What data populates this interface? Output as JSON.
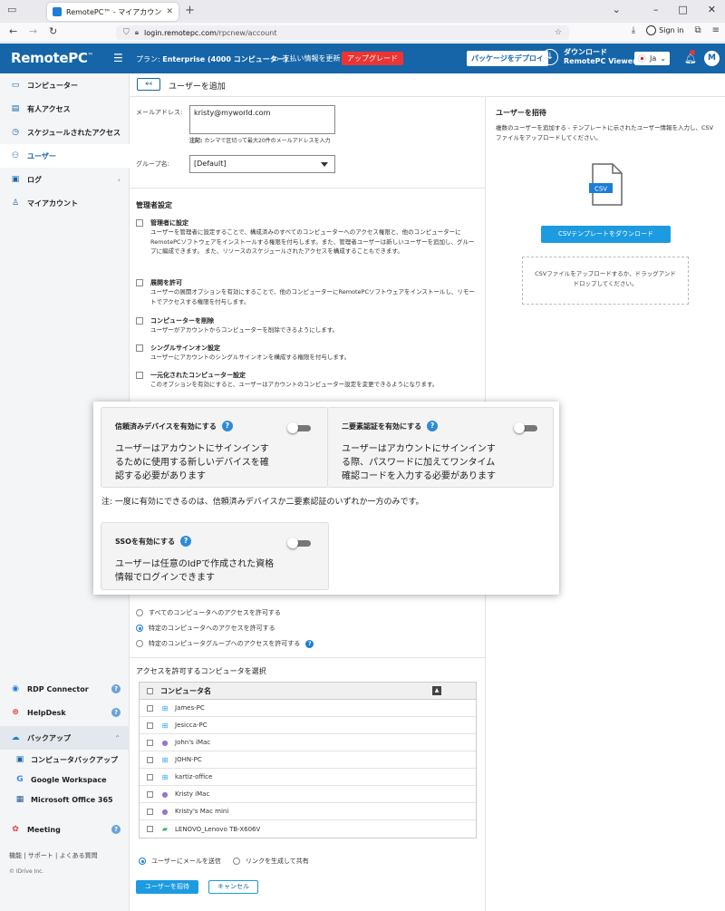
{
  "browser": {
    "tab_title": "RemotePC™ - マイアカウント-M",
    "url_host": "login.remotepc.com",
    "url_path": "/rpcnew/account",
    "signin_label": "Sign in"
  },
  "header": {
    "logo": "RemotePC",
    "logo_tm": "™",
    "plan_prefix": "プラン:",
    "plan_value": "Enterprise (4000 コンピューター)",
    "billing_label": "支払い情報を更新",
    "upgrade_label": "アップグレード",
    "deploy_label": "パッケージをデプロイ",
    "download_line1": "ダウンロード",
    "download_line2": "RemotePC Viewer",
    "lang_label": "Ja",
    "avatar_letter": "M"
  },
  "sidebar": {
    "items": [
      {
        "label": "コンピューター",
        "icon": "monitor-icon"
      },
      {
        "label": "有人アクセス",
        "icon": "attended-icon"
      },
      {
        "label": "スケジュールされたアクセス",
        "icon": "schedule-icon"
      },
      {
        "label": "ユーザー",
        "icon": "users-icon"
      },
      {
        "label": "ログ",
        "icon": "log-icon"
      },
      {
        "label": "マイアカウント",
        "icon": "account-icon"
      }
    ],
    "bottom": {
      "rdp": "RDP Connector",
      "helpdesk": "HelpDesk",
      "backup": "バックアップ",
      "backup_sub": [
        "コンピュータバックアップ",
        "Google Workspace",
        "Microsoft Office 365"
      ],
      "meeting": "Meeting"
    },
    "footer_links": "機能 | サポート | よくある質問",
    "copyright": "© IDrive Inc."
  },
  "page": {
    "title": "ユーザーを追加",
    "back_label": "↤"
  },
  "form": {
    "email_label": "メールアドレス:",
    "email_value": "kristy@myworld.com",
    "hint_bold": "注記:",
    "hint_text": " カンマで区切って最大20件のメールアドレスを入力",
    "group_label": "グループ名:",
    "group_value": "[Default]",
    "admin_section": "管理者設定",
    "permissions": [
      {
        "title": "管理者に設定",
        "desc": "ユーザーを管理者に設定することで、構成済みのすべてのコンピューターへのアクセス権限と、他のコンピューターにRemotePCソフトウェアをインストールする権限を付与します。また、管理者ユーザーは新しいユーザーを追加し、グループに編成できます。 また、リソースのスケジュールされたアクセスを構成することもできます。"
      },
      {
        "title": "展開を許可",
        "desc": "ユーザーの展開オプションを有効にすることで、他のコンピューターにRemotePCソフトウェアをインストールし、リモートでアクセスする権限を付与します。"
      },
      {
        "title": "コンピューターを削除",
        "desc": "ユーザーがアカウントからコンピューターを削除できるようにします。"
      },
      {
        "title": "シングルサインオン設定",
        "desc": "ユーザーにアカウントのシングルサインオンを構成する権限を付与します。"
      },
      {
        "title": "一元化されたコンピューター設定",
        "desc": "このオプションを有効にすると、ユーザーはアカウントのコンピューター設定を変更できるようになります。"
      }
    ],
    "access_options": [
      {
        "label": "すべてのコンピュータへのアクセスを許可する",
        "selected": false
      },
      {
        "label": "特定のコンピュータへのアクセスを許可する",
        "selected": true
      },
      {
        "label": "特定のコンピュータグループへのアクセスを許可する",
        "selected": false
      }
    ],
    "select_section": "アクセスを許可するコンピュータを選択",
    "table_header": "コンピュータ名",
    "computers": [
      {
        "name": "James-PC",
        "os": "windows"
      },
      {
        "name": "Jesicca-PC",
        "os": "windows"
      },
      {
        "name": "John's iMac",
        "os": "mac"
      },
      {
        "name": "JOHN-PC",
        "os": "windows"
      },
      {
        "name": "kartiz-office",
        "os": "windows"
      },
      {
        "name": "Kristy iMac",
        "os": "mac"
      },
      {
        "name": "Kristy's Mac mini",
        "os": "mac"
      },
      {
        "name": "LENOVO_Lenovo TB-X606V",
        "os": "android"
      }
    ],
    "invite_methods": [
      {
        "label": "ユーザーにメールを送信",
        "selected": true
      },
      {
        "label": "リンクを生成して共有",
        "selected": false
      }
    ],
    "invite_button": "ユーザーを招待",
    "cancel_button": "キャンセル"
  },
  "invite_panel": {
    "title": "ユーザーを招待",
    "desc": "複数のユーザーを追加する - テンプレートに示されたユーザー情報を入力し、CSVファイルをアップロードしてください。",
    "csv_badge": "CSV",
    "csv_button": "CSVテンプレートをダウンロード",
    "drop_text": "CSVファイルをアップロードするか、ドラッグアンドドロップしてください。"
  },
  "overlay": {
    "trusted_title": "信頼済みデバイスを有効にする",
    "trusted_desc_1": "ユーザーはアカウントにサインインす",
    "trusted_desc_2": "るために使用する新しいデバイスを確",
    "trusted_desc_3": "認する必要があります",
    "tfa_title": "二要素認証を有効にする",
    "tfa_desc_1": "ユーザーはアカウントにサインインす",
    "tfa_desc_2": "る際、パスワードに加えてワンタイム",
    "tfa_desc_3": "確認コードを入力する必要があります",
    "note": "注: 一度に有効にできるのは、信頼済みデバイスか二要素認証のいずれか一方のみです。",
    "sso_title": "SSOを有効にする",
    "sso_desc_1": "ユーザーは任意のIdPで作成された資格",
    "sso_desc_2": "情報でログインできます",
    "help_glyph": "?"
  },
  "colors": {
    "brand": "#1565a8",
    "accent": "#1d9be0",
    "upgrade": "#e33333"
  }
}
